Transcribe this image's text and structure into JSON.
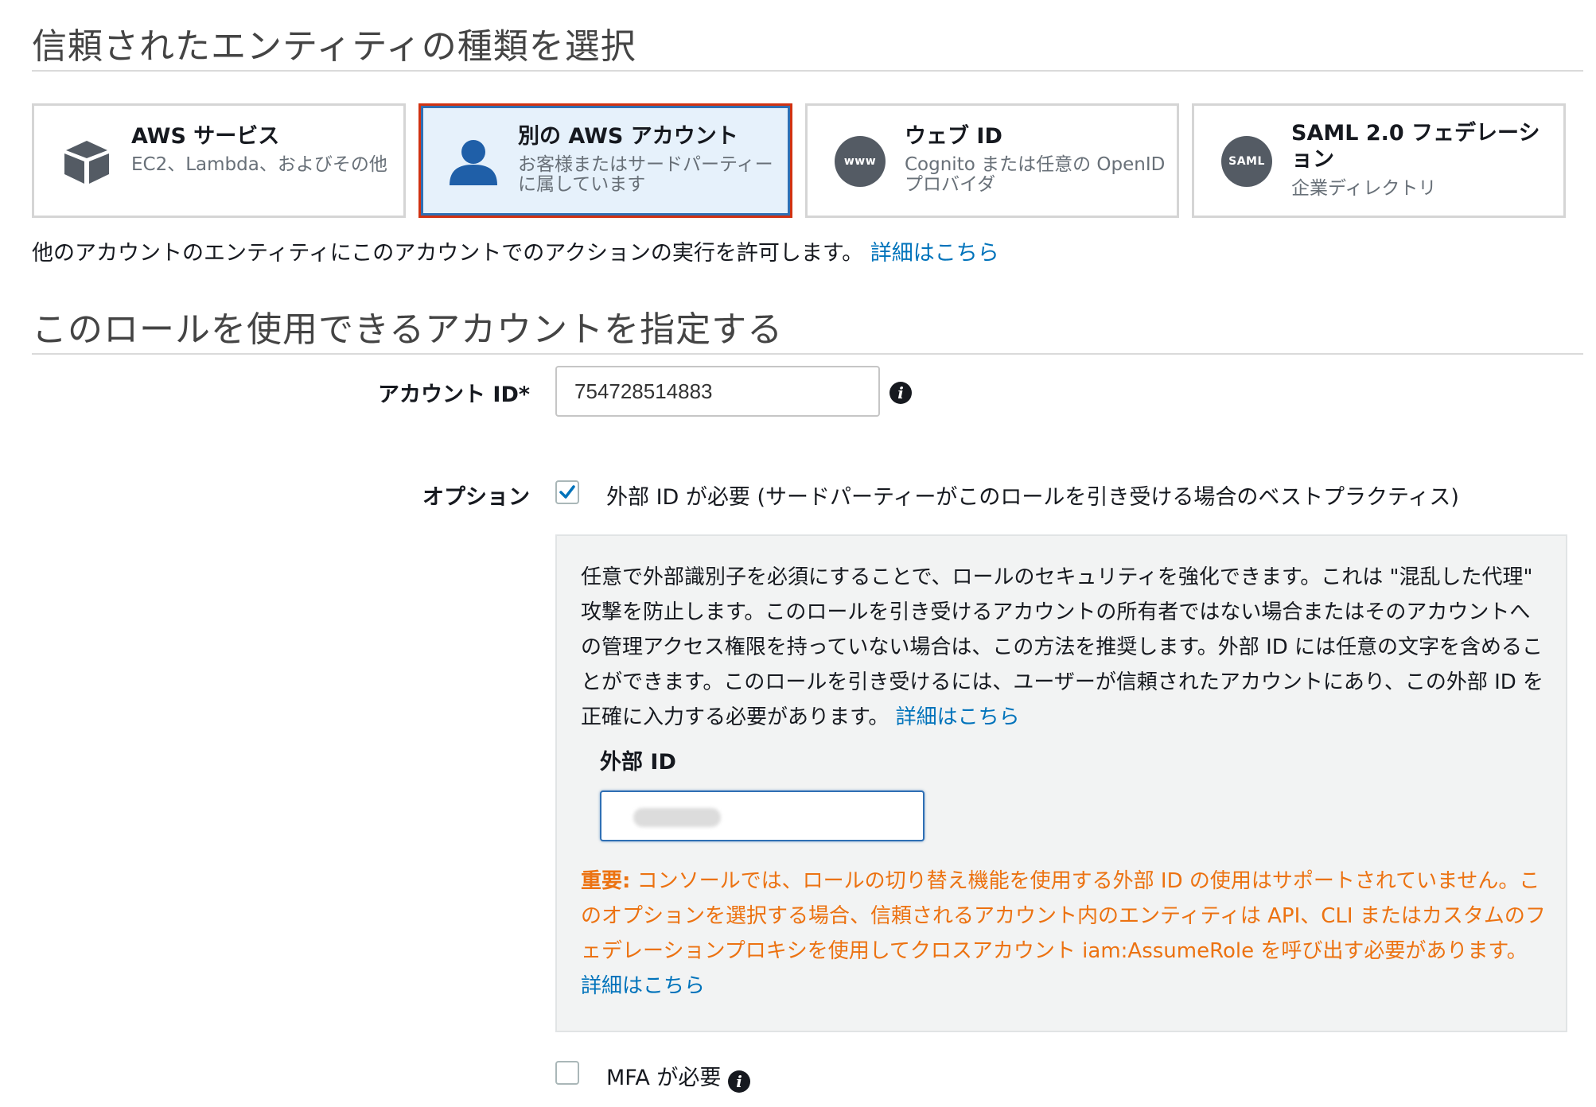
{
  "section1": {
    "title": "信頼されたエンティティの種類を選択",
    "cards": [
      {
        "title": "AWS サービス",
        "subtitle": "EC2、Lambda、およびその他",
        "icon": "cube-icon",
        "selected": false
      },
      {
        "title": "別の AWS アカウント",
        "subtitle": "お客様またはサードパーティーに属しています",
        "icon": "user-icon",
        "selected": true
      },
      {
        "title": "ウェブ ID",
        "subtitle": "Cognito または任意の OpenID プロバイダ",
        "icon": "www-icon",
        "icon_text": "www",
        "selected": false
      },
      {
        "title": "SAML 2.0 フェデレーション",
        "subtitle": "企業ディレクトリ",
        "icon": "saml-icon",
        "icon_text": "SAML",
        "selected": false
      }
    ],
    "description": "他のアカウントのエンティティにこのアカウントでのアクションの実行を許可します。",
    "learn_more": "詳細はこちら"
  },
  "section2": {
    "title": "このロールを使用できるアカウントを指定する",
    "account_id_label": "アカウント ID*",
    "account_id_value": "754728514883",
    "options_label": "オプション",
    "require_external_id": {
      "checked": true,
      "label": "外部 ID が必要 (サードパーティーがこのロールを引き受ける場合のベストプラクティス)"
    },
    "panel": {
      "text": "任意で外部識別子を必須にすることで、ロールのセキュリティを強化できます。これは \"混乱した代理\" 攻撃を防止します。このロールを引き受けるアカウントの所有者ではない場合またはそのアカウントへの管理アクセス権限を持っていない場合は、この方法を推奨します。外部 ID には任意の文字を含めることができます。このロールを引き受けるには、ユーザーが信頼されたアカウントにあり、この外部 ID を正確に入力する必要があります。",
      "learn_more": "詳細はこちら",
      "external_id_label": "外部 ID",
      "warning_prefix": "重要:",
      "warning_text": " コンソールでは、ロールの切り替え機能を使用する外部 ID の使用はサポートされていません。このオプションを選択する場合、信頼されるアカウント内のエンティティは API、CLI またはカスタムのフェデレーションプロキシを使用してクロスアカウント iam:AssumeRole を呼び出す必要があります。",
      "warning_learn_more": "詳細はこちら"
    },
    "require_mfa": {
      "checked": false,
      "label": "MFA が必要"
    }
  },
  "colors": {
    "link": "#0073bb",
    "warning": "#ec7211",
    "selected_border": "#d13212",
    "selected_bg": "#e6f1fb",
    "check": "#0073bb"
  }
}
